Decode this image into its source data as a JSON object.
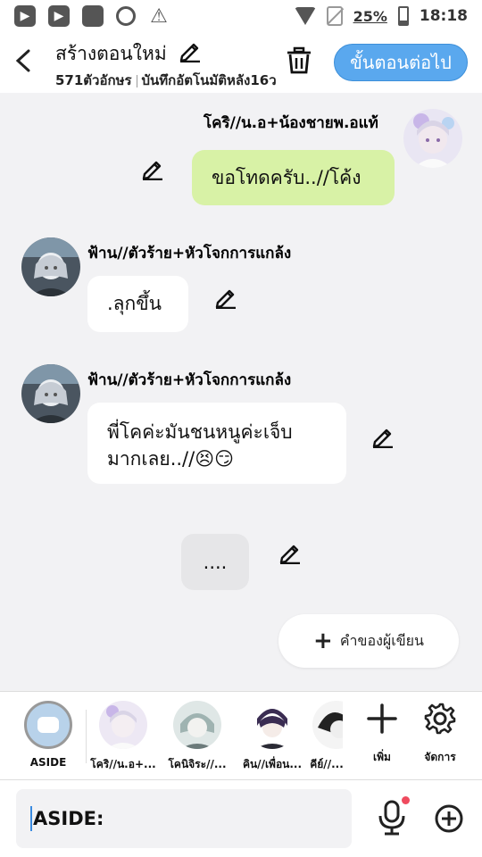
{
  "status_bar": {
    "battery": "25%",
    "time": "18:18"
  },
  "header": {
    "title": "สร้างตอนใหม่",
    "char_count": "571ตัวอักษร",
    "autosave": "บันทึกอัตโนมัติหลัง16ว",
    "next_label": "ขั้นตอนต่อไป",
    "next_color": "#5aa8ee"
  },
  "messages": [
    {
      "side": "right",
      "name": "โคริ//น.อ+น้องชายพ.อแท้",
      "text": "ขอโทดครับ..//โค้ง",
      "bubble_color": "#d8f2a6"
    },
    {
      "side": "left",
      "name": "ฟ้าน//ตัวร้าย+หัวโจกการแกล้ง",
      "text": ".ลุกขึ้น",
      "bubble_color": "#ffffff"
    },
    {
      "side": "left",
      "name": "ฟ้าน//ตัวร้าย+หัวโจกการแกล้ง",
      "text_line1": "พี่โคค่ะมันชนหนูค่ะเจ็บ",
      "text_line2": "มากเลย..//",
      "emoji": [
        "😣",
        "😏"
      ],
      "bubble_color": "#ffffff"
    },
    {
      "side": "center",
      "text": "...."
    }
  ],
  "author_button": {
    "label": "คำของผู้เขียน"
  },
  "characters": [
    {
      "label": "ASIDE",
      "icon": "chat-bubble-icon"
    },
    {
      "label": "โคริ//น.อ+..."
    },
    {
      "label": "โคนิจิระ//..."
    },
    {
      "label": "คิน//เพื่อน..."
    },
    {
      "label": "คีย์//..."
    }
  ],
  "tools": {
    "add_label": "เพิ่ม",
    "manage_label": "จัดการ"
  },
  "input": {
    "value": "ASIDE:"
  }
}
